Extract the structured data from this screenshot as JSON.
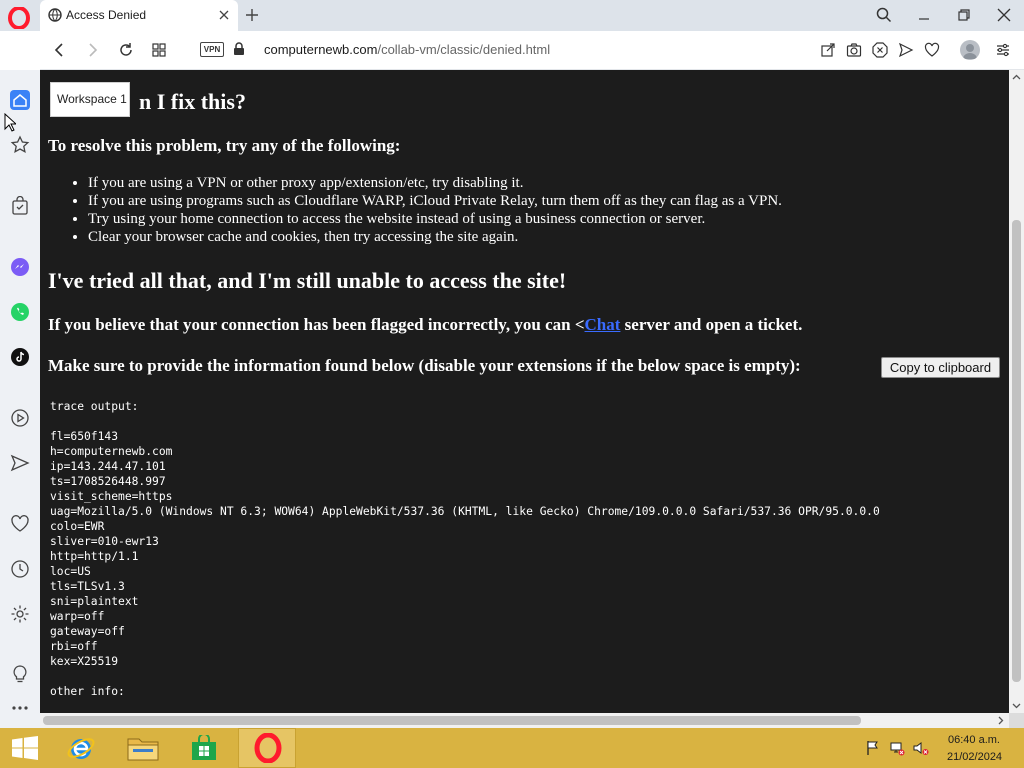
{
  "browser": {
    "tab_title": "Access Denied",
    "url_domain": "computernewb.com",
    "url_path": "/collab-vm/classic/denied.html",
    "vpn_label": "VPN",
    "accent_color": "#ff1b2d"
  },
  "sidebar": {
    "tooltip": "Workspace 1",
    "icons": [
      "home-icon",
      "star-icon",
      "bag-icon",
      "messenger-icon",
      "whatsapp-icon",
      "tiktok-icon",
      "player-icon",
      "send-icon",
      "heart-icon",
      "history-icon",
      "settings-icon",
      "lightbulb-icon",
      "more-icon"
    ]
  },
  "page": {
    "heading_fix_visible": "n I fix this?",
    "resolve_heading": "To resolve this problem, try any of the following:",
    "bullets": [
      "If you are using a VPN or other proxy app/extension/etc, try disabling it.",
      "If you are using programs such as Cloudflare WARP, iCloud Private Relay, turn them off as they can flag as a VPN.",
      "Try using your home connection to access the website instead of using a business connection or server.",
      "Clear your browser cache and cookies, then try accessing the site again."
    ],
    "tried_heading": "I've tried all that, and I'm still unable to access the site!",
    "believe_prefix": "If you believe that your connection has been flagged incorrectly, you can <",
    "believe_link": "Chat",
    "believe_suffix": " server and open a ticket.",
    "provide_text": "Make sure to provide the information found below (disable your extensions if the below space is empty):",
    "copy_button": "Copy to clipboard",
    "trace_label": "trace output:",
    "trace_lines": [
      "fl=650f143",
      "h=computernewb.com",
      "ip=143.244.47.101",
      "ts=1708526448.997",
      "visit_scheme=https",
      "uag=Mozilla/5.0 (Windows NT 6.3; WOW64) AppleWebKit/537.36 (KHTML, like Gecko) Chrome/109.0.0.0 Safari/537.36 OPR/95.0.0.0",
      "colo=EWR",
      "sliver=010-ewr13",
      "http=http/1.1",
      "loc=US",
      "tls=TLSv1.3",
      "sni=plaintext",
      "warp=off",
      "gateway=off",
      "rbi=off",
      "kex=X25519"
    ],
    "other_info_label": "other info:"
  },
  "taskbar": {
    "time": "06:40 a.m.",
    "date": "21/02/2024",
    "apps": [
      "start-icon",
      "internet-explorer-icon",
      "file-explorer-icon",
      "store-icon",
      "opera-icon"
    ]
  }
}
